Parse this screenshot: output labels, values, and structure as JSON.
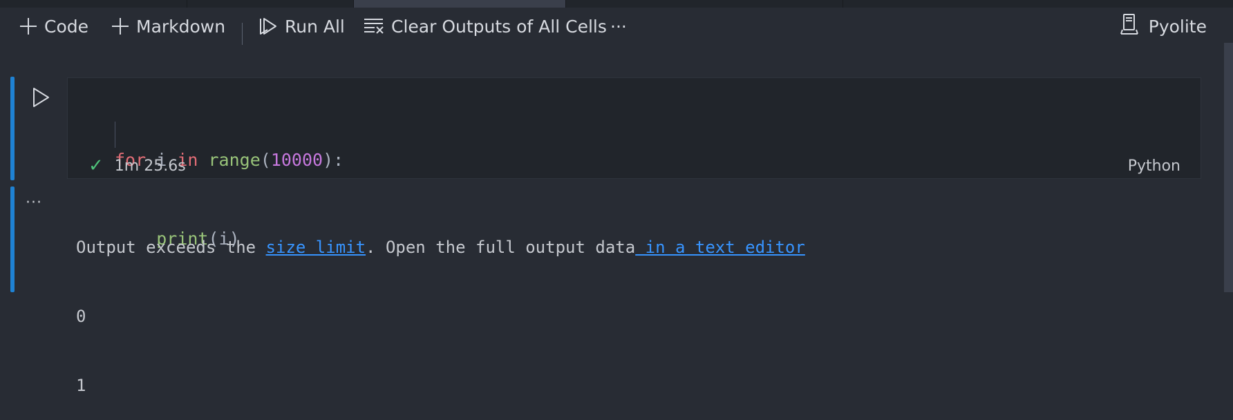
{
  "toolbar": {
    "add_code_label": "Code",
    "add_markdown_label": "Markdown",
    "run_all_label": "Run All",
    "clear_outputs_label": "Clear Outputs of All Cells",
    "more_label": "···",
    "kernel_label": "Pyolite"
  },
  "cell": {
    "code": {
      "line1": {
        "kw_for": "for",
        "var": " i ",
        "kw_in": "in",
        "sp": " ",
        "fn_range": "range",
        "open": "(",
        "num": "10000",
        "close": "):"
      },
      "line2": {
        "fn_print": "print",
        "args": "(i)"
      }
    },
    "status": {
      "check_symbol": "✓",
      "time": "1m 25.6s",
      "language": "Python"
    }
  },
  "output": {
    "more_label": "···",
    "message": {
      "part1": "Output exceeds the ",
      "link1": "size limit",
      "part2": ". Open the full output data",
      "link2": " in a text editor"
    },
    "lines": [
      "0",
      "1"
    ]
  },
  "colors": {
    "background": "#282c34",
    "editor_background": "#21252b",
    "accent_bar": "#1f82d3",
    "keyword": "#e06c75",
    "function": "#98c379",
    "number": "#c678dd",
    "link": "#3794ff",
    "success_check": "#4ec27a"
  },
  "icons": {
    "add_code": "plus-icon",
    "add_markdown": "plus-icon",
    "run_all": "run-all-icon",
    "clear_outputs": "clear-all-icon",
    "kernel": "server-environment-icon",
    "run_cell": "play-icon",
    "success": "check-icon"
  }
}
